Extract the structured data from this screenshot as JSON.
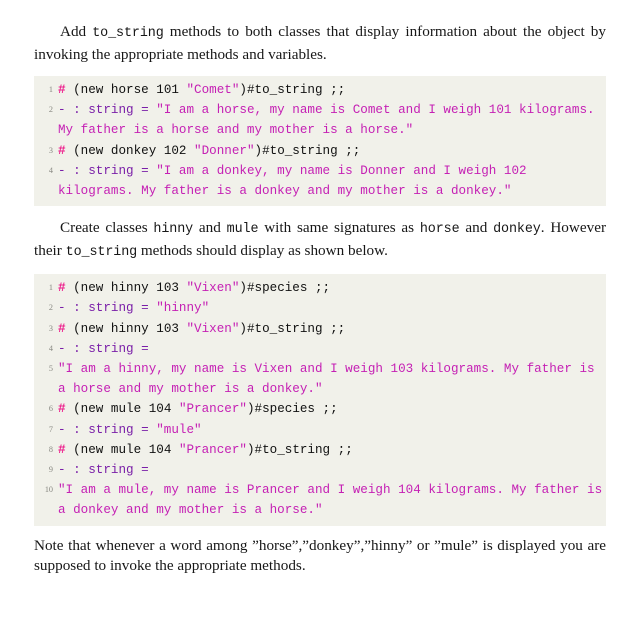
{
  "document": {
    "paragraphs": {
      "intro": {
        "part1": "Add ",
        "code1": "to_string",
        "part2": " methods to both classes that display information about the object by invoking the appropriate methods and variables."
      },
      "middle": {
        "part1": "Create classes ",
        "code1": "hinny",
        "part2": " and ",
        "code2": "mule",
        "part3": " with same signatures as ",
        "code3": "horse",
        "part4": " and ",
        "code4": "donkey",
        "part5": ". However their ",
        "code5": "to_string",
        "part6": " methods should display as shown below."
      },
      "closing": {
        "text": "Note that whenever a word among ”horse”,”donkey”,”hinny” or ”mule” is displayed you are supposed to invoke the appropriate methods."
      }
    },
    "listing_one": {
      "lines": [
        {
          "number": "1",
          "segments": [
            {
              "cls": "c-prompt",
              "text": "# "
            },
            {
              "cls": "c-plain",
              "text": "(new horse 101 "
            },
            {
              "cls": "c-str",
              "text": "\"Comet\""
            },
            {
              "cls": "c-plain",
              "text": ")#to_string ;;"
            }
          ]
        },
        {
          "number": "2",
          "segments": [
            {
              "cls": "c-out",
              "text": "- : string = "
            },
            {
              "cls": "c-outstr",
              "text": "\"I am a horse, my name is Comet and I weigh 101 kilograms. My father is a horse and my mother is a horse.\""
            }
          ]
        },
        {
          "number": "3",
          "segments": [
            {
              "cls": "c-prompt",
              "text": "# "
            },
            {
              "cls": "c-plain",
              "text": "(new donkey 102 "
            },
            {
              "cls": "c-str",
              "text": "\"Donner\""
            },
            {
              "cls": "c-plain",
              "text": ")#to_string ;;"
            }
          ]
        },
        {
          "number": "4",
          "segments": [
            {
              "cls": "c-out",
              "text": "- : string = "
            },
            {
              "cls": "c-outstr",
              "text": "\"I am a donkey, my name is Donner and I weigh 102 kilograms. My father is a donkey and my mother is a donkey.\""
            }
          ]
        }
      ]
    },
    "listing_two": {
      "lines": [
        {
          "number": "1",
          "segments": [
            {
              "cls": "c-prompt",
              "text": "# "
            },
            {
              "cls": "c-plain",
              "text": "(new hinny 103 "
            },
            {
              "cls": "c-str",
              "text": "\"Vixen\""
            },
            {
              "cls": "c-plain",
              "text": ")#species ;;"
            }
          ]
        },
        {
          "number": "2",
          "segments": [
            {
              "cls": "c-out",
              "text": "- : string = "
            },
            {
              "cls": "c-outstr",
              "text": "\"hinny\""
            }
          ]
        },
        {
          "number": "3",
          "segments": [
            {
              "cls": "c-prompt",
              "text": "# "
            },
            {
              "cls": "c-plain",
              "text": "(new hinny 103 "
            },
            {
              "cls": "c-str",
              "text": "\"Vixen\""
            },
            {
              "cls": "c-plain",
              "text": ")#to_string ;;"
            }
          ]
        },
        {
          "number": "4",
          "segments": [
            {
              "cls": "c-out",
              "text": "- : string ="
            }
          ]
        },
        {
          "number": "5",
          "segments": [
            {
              "cls": "c-outstr",
              "text": "\"I am a hinny, my name is Vixen and I weigh 103 kilograms. My father is a horse and my mother is a donkey.\""
            }
          ]
        },
        {
          "number": "6",
          "segments": [
            {
              "cls": "c-prompt",
              "text": "# "
            },
            {
              "cls": "c-plain",
              "text": "(new mule 104 "
            },
            {
              "cls": "c-str",
              "text": "\"Prancer\""
            },
            {
              "cls": "c-plain",
              "text": ")#species ;;"
            }
          ]
        },
        {
          "number": "7",
          "segments": [
            {
              "cls": "c-out",
              "text": "- : string = "
            },
            {
              "cls": "c-outstr",
              "text": "\"mule\""
            }
          ]
        },
        {
          "number": "8",
          "segments": [
            {
              "cls": "c-prompt",
              "text": "# "
            },
            {
              "cls": "c-plain",
              "text": "(new mule 104 "
            },
            {
              "cls": "c-str",
              "text": "\"Prancer\""
            },
            {
              "cls": "c-plain",
              "text": ")#to_string ;;"
            }
          ]
        },
        {
          "number": "9",
          "segments": [
            {
              "cls": "c-out",
              "text": "- : string ="
            }
          ]
        },
        {
          "number": "10",
          "segments": [
            {
              "cls": "c-outstr",
              "text": "\"I am a mule, my name is Prancer and I weigh 104 kilograms. My father is a donkey and my mother is a horse.\""
            }
          ]
        }
      ]
    },
    "colors": {
      "listing_background": "#f1f1ea",
      "prompt": "#ed1e8c",
      "string_literal": "#c520b4",
      "output_type": "#7a1fa8",
      "body_text": "#171717",
      "line_number": "#888882"
    }
  }
}
